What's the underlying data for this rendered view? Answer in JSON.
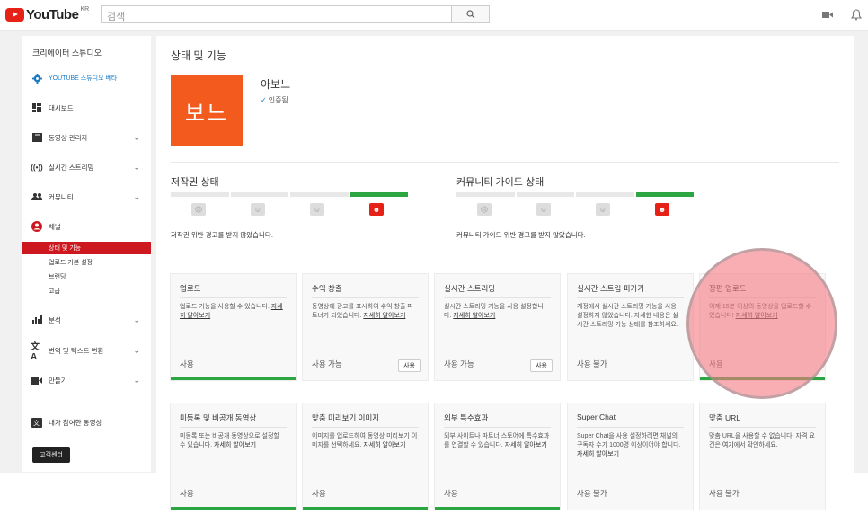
{
  "topbar": {
    "logo_text": "YouTube",
    "region": "KR",
    "search_placeholder": "검색"
  },
  "sidebar": {
    "title": "크리에이터 스튜디오",
    "beta": "YOUTUBE 스튜디오 베타",
    "items": [
      {
        "label": "대시보드",
        "icon": "dashboard-icon"
      },
      {
        "label": "동영상 관리자",
        "icon": "video-manager-icon"
      },
      {
        "label": "실시간 스트리밍",
        "icon": "live-icon"
      },
      {
        "label": "커뮤니티",
        "icon": "community-icon"
      },
      {
        "label": "채널",
        "icon": "channel-icon"
      }
    ],
    "sub_items": [
      "상태 및 기능",
      "업로드 기본 설정",
      "브랜딩",
      "고급"
    ],
    "more_items": [
      {
        "label": "분석",
        "icon": "analytics-icon"
      },
      {
        "label": "번역 및 텍스트 변환",
        "icon": "translate-icon"
      },
      {
        "label": "만들기",
        "icon": "create-icon"
      },
      {
        "label": "내가 참여한 동영상",
        "icon": "contributions-icon"
      }
    ],
    "help": "고객센터"
  },
  "main": {
    "title": "상태 및 기능",
    "avatar_text": "보느",
    "channel_name": "아보느",
    "verified": "인증됨",
    "copyright": {
      "title": "저작권 상태",
      "message": "저작권 위반 경고를 받지 않았습니다."
    },
    "community": {
      "title": "커뮤니티 가이드 상태",
      "message": "커뮤니티 가이드 위반 경고를 받지 않았습니다."
    },
    "cards": [
      {
        "title": "업로드",
        "desc": "업로드 기능을 사용할 수 있습니다. ",
        "link": "자세히 알아보기",
        "status": "사용",
        "button": "",
        "green": true
      },
      {
        "title": "수익 창출",
        "desc": "동영상에 광고를 표시하여 수익 창출 파트너가 되었습니다. ",
        "link": "자세히 알아보기",
        "status": "사용 가능",
        "button": "사용",
        "green": false
      },
      {
        "title": "실시간 스트리밍",
        "desc": "실시간 스트리밍 기능을 사용 설정합니다. ",
        "link": "자세히 알아보기",
        "status": "사용 가능",
        "button": "사용",
        "green": false
      },
      {
        "title": "실시간 스트림 퍼가기",
        "desc": "계정에서 실시간 스트리밍 기능을 사용 설정하지 않았습니다. 자세한 내용은 실시간 스트리밍 기능 상태를 참조하세요.",
        "link": "",
        "status": "사용 불가",
        "button": "",
        "green": false
      },
      {
        "title": "장편 업로드",
        "desc": "이제 15분 이상의 동영상을 업로드할 수 있습니다! ",
        "link": "자세히 알아보기",
        "status": "사용",
        "button": "",
        "green": true
      },
      {
        "title": "미등록 및 비공개 동영상",
        "desc": "미등록 또는 비공개 동영상으로 설정할 수 있습니다. ",
        "link": "자세히 알아보기",
        "status": "사용",
        "button": "",
        "green": true
      },
      {
        "title": "맞춤 미리보기 이미지",
        "desc": "이미지를 업로드하여 동영상 미리보기 이미지를 선택하세요. ",
        "link": "자세히 알아보기",
        "status": "사용",
        "button": "",
        "green": true
      },
      {
        "title": "외부 특수효과",
        "desc": "외부 사이트나 파트너 스토어에 특수효과를 연결할 수 있습니다. ",
        "link": "자세히 알아보기",
        "status": "사용",
        "button": "",
        "green": true
      },
      {
        "title": "Super Chat",
        "desc": "Super Chat을 사용 설정하려면 채널의 구독자 수가 1000명 이상이어야 합니다. ",
        "link": "자세히 알아보기",
        "status": "사용 불가",
        "button": "",
        "green": false
      },
      {
        "title": "맞춤 URL",
        "desc": "맞춤 URL을 사용할 수 없습니다. 자격 요건은 ",
        "link": "여기",
        "desc2": "에서 확인하세요.",
        "status": "사용 불가",
        "button": "",
        "green": false
      }
    ]
  },
  "colors": {
    "accent_red": "#cc181e",
    "avatar_orange": "#f25a1e",
    "status_green": "#2ba640",
    "link_blue": "#167ac6"
  }
}
